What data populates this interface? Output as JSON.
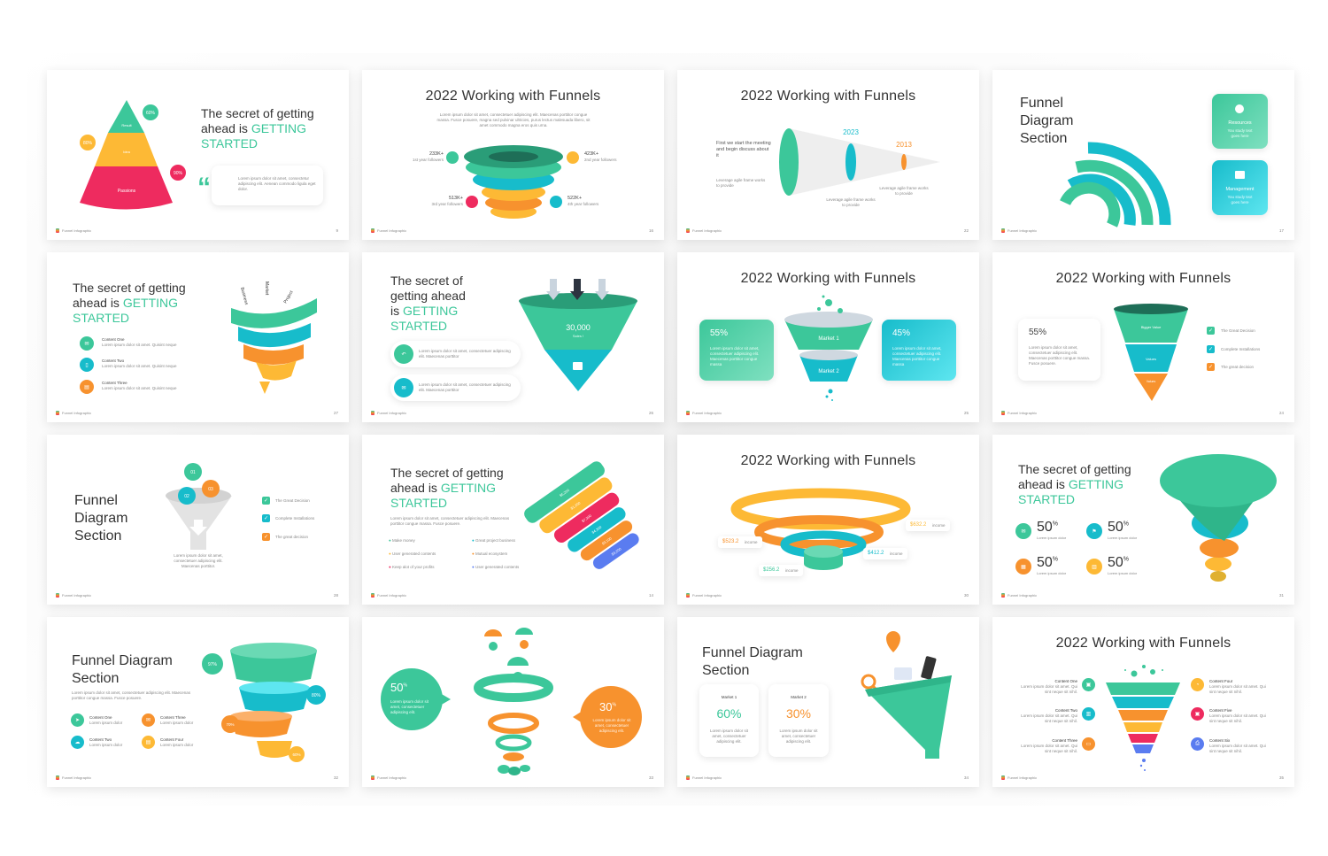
{
  "footer_label": "Funnel Infographic",
  "colors": {
    "green": "#3cc79a",
    "teal": "#17bccb",
    "orange": "#f7922e",
    "yellow": "#fdb935",
    "pink": "#ee2b5f",
    "blue": "#5a7cf0",
    "text": "#333333"
  },
  "slides": [
    {
      "page": "9",
      "title_pre": "The secret of getting ahead is ",
      "title_accent": "GETTING STARTED",
      "badges": [
        "60%",
        "80%",
        "90%"
      ],
      "layers": [
        "Result",
        "Idea",
        "Passions"
      ],
      "quote": "Lorem ipsum dolor sit amet, consectetur adipiscing elit. Aenean commodo ligula eget dolor."
    },
    {
      "page": "16",
      "title": "2022 Working with Funnels",
      "subtitle": "Lorem ipsum dolor sit amet, consectetuer adipiscing elit. Maecenas porttitor congue massa. Fusce posuere, magna sed pulvinar ultricies, purus lectus malesuada libero, sit amet commodo magna eros quis urna.",
      "stats": [
        {
          "value": "233K+",
          "label": "1st year followers"
        },
        {
          "value": "423K+",
          "label": "2nd year followers"
        },
        {
          "value": "513K+",
          "label": "3rd year followers"
        },
        {
          "value": "522K+",
          "label": "4th year followers"
        }
      ]
    },
    {
      "page": "22",
      "title": "2022 Working with Funnels",
      "lead": "First we start the meeting and begin discuss about it",
      "note": "Leverage agile frame works to provide",
      "years": [
        "2023",
        "2013"
      ],
      "year_notes": [
        "Leverage agile frame works to provide",
        "Leverage agile frame works to provide"
      ]
    },
    {
      "page": "17",
      "title": "Funnel Diagram Section",
      "cards": [
        {
          "label": "Resources",
          "text": "You study text goes here"
        },
        {
          "label": "Management",
          "text": "You study text goes here"
        }
      ]
    },
    {
      "page": "27",
      "title_pre": "The secret of getting ahead is ",
      "title_accent": "GETTING STARTED",
      "spiral_labels": [
        "Business",
        "Market",
        "Project"
      ],
      "items": [
        {
          "title": "Content One",
          "text": "Lorem ipsum dolor sit amet. Quisint neque"
        },
        {
          "title": "Content Two",
          "text": "Lorem ipsum dolor sit amet. Quisint neque"
        },
        {
          "title": "Content Three",
          "text": "Lorem ipsum dolor sit amet. Quisint neque"
        }
      ]
    },
    {
      "page": "26",
      "title_pre": "The secret of getting ahead is ",
      "title_accent": "GETTING STARTED",
      "value": "30,000",
      "value_label": "Sales !",
      "items": [
        "Lorem ipsum dolor sit amet, consectetuer adipiscing elit. Maecenas porttitor",
        "Lorem ipsum dolor sit amet, consectetuer adipiscing elit. Maecenas porttitor"
      ]
    },
    {
      "page": "25",
      "title": "2022 Working with Funnels",
      "left": {
        "value": "55%",
        "text": "Lorem ipsum dolor sit amet, consectetuer adipiscing elit. Maecenas porttitor congue massa"
      },
      "right": {
        "value": "45%",
        "text": "Lorem ipsum dolor sit amet, consectetuer adipiscing elit. Maecenas porttitor congue massa"
      },
      "layers": [
        "Market 1",
        "Market 2"
      ]
    },
    {
      "page": "24",
      "title": "2022 Working with Funnels",
      "card": {
        "value": "55%",
        "text": "Lorem ipsum dolor sit amet, consectetuer adipiscing elit. Maecenas porttitor congue massa. Fusce posuere."
      },
      "layers": [
        "Bigger Value",
        "Values",
        "Values"
      ],
      "legend": [
        "The Great Decision",
        "Complete Installations",
        "The great decision"
      ]
    },
    {
      "page": "28",
      "title": "Funnel Diagram Section",
      "balls": [
        "01",
        "02",
        "03"
      ],
      "text": "Lorem ipsum dolor sit amet, consectetuer adipiscing elit. Maecenas porttitor.",
      "legend": [
        "The Great Decision",
        "Complete Installations",
        "The great decision"
      ]
    },
    {
      "page": "14",
      "title_pre": "The secret of getting ahead is ",
      "title_accent": "GETTING STARTED",
      "text": "Lorem ipsum dolor sit amet, consectetuer adipiscing elit. Maecenas porttitor congue massa. Fusce posuere.",
      "items": [
        "Make money",
        "Great project business",
        "User generated contents",
        "Mutual ecosystem",
        "Keep alot of your profits",
        "User generated contents"
      ],
      "layers": [
        "$5,200",
        "$1,200",
        "$7,300",
        "$4,300",
        "$3,100",
        "$3,200"
      ]
    },
    {
      "page": "30",
      "title": "2022 Working with Funnels",
      "labels": [
        {
          "value": "$632.2",
          "unit": "income"
        },
        {
          "value": "$523.2",
          "unit": "income"
        },
        {
          "value": "$412.2",
          "unit": "income"
        },
        {
          "value": "$256.2",
          "unit": "income"
        }
      ]
    },
    {
      "page": "31",
      "title_pre": "The secret of getting ahead is ",
      "title_accent": "GETTING STARTED",
      "stats": [
        {
          "value": "50",
          "unit": "%",
          "text": "Lorem ipsum dolor"
        },
        {
          "value": "50",
          "unit": "%",
          "text": "Lorem ipsum dolor"
        },
        {
          "value": "50",
          "unit": "%",
          "text": "Lorem ipsum dolor"
        },
        {
          "value": "50",
          "unit": "%",
          "text": "Lorem ipsum dolor"
        }
      ]
    },
    {
      "page": "32",
      "title": "Funnel Diagram Section",
      "text": "Lorem ipsum dolor sit amet, consectetuer adipiscing elit. Maecenas porttitor congue massa. Fusce posuere.",
      "items": [
        {
          "title": "Content One",
          "text": "Lorem ipsum dolor"
        },
        {
          "title": "Content Three",
          "text": "Lorem ipsum dolor"
        },
        {
          "title": "Content Two",
          "text": "Lorem ipsum dolor"
        },
        {
          "title": "Content Four",
          "text": "Lorem ipsum dolor"
        }
      ],
      "badges": [
        "97%",
        "80%",
        "70%",
        "60%"
      ]
    },
    {
      "page": "33",
      "left": {
        "value": "50",
        "unit": "%",
        "text": "Lorem ipsum dolor sit amet, consectetuer adipiscing elit."
      },
      "right": {
        "value": "30",
        "unit": "%",
        "text": "Lorem ipsum dolor sit amet, consectetuer adipiscing elit."
      }
    },
    {
      "page": "34",
      "title": "Funnel Diagram Section",
      "cards": [
        {
          "label": "Market 1",
          "value": "60%",
          "text": "Lorem ipsum dolor sit amet, consectetuer adipiscing elit."
        },
        {
          "label": "Market 2",
          "value": "30%",
          "text": "Lorem ipsum dolor sit amet, consectetuer adipiscing elit."
        }
      ]
    },
    {
      "page": "35",
      "title": "2022 Working with Funnels",
      "items": [
        {
          "title": "Content One",
          "text": "Lorem ipsum dolor sit amet. Qui sint neque sit nihil."
        },
        {
          "title": "Content Two",
          "text": "Lorem ipsum dolor sit amet. Qui sint neque sit nihil."
        },
        {
          "title": "Content Three",
          "text": "Lorem ipsum dolor sit amet. Qui sint neque sit nihil."
        },
        {
          "title": "Content Four",
          "text": "Lorem ipsum dolor sit amet. Qui sint neque sit nihil."
        },
        {
          "title": "Content Five",
          "text": "Lorem ipsum dolor sit amet. Qui sint neque sit nihil."
        },
        {
          "title": "Content Six",
          "text": "Lorem ipsum dolor sit amet. Qui sint neque sit nihil."
        }
      ]
    }
  ]
}
